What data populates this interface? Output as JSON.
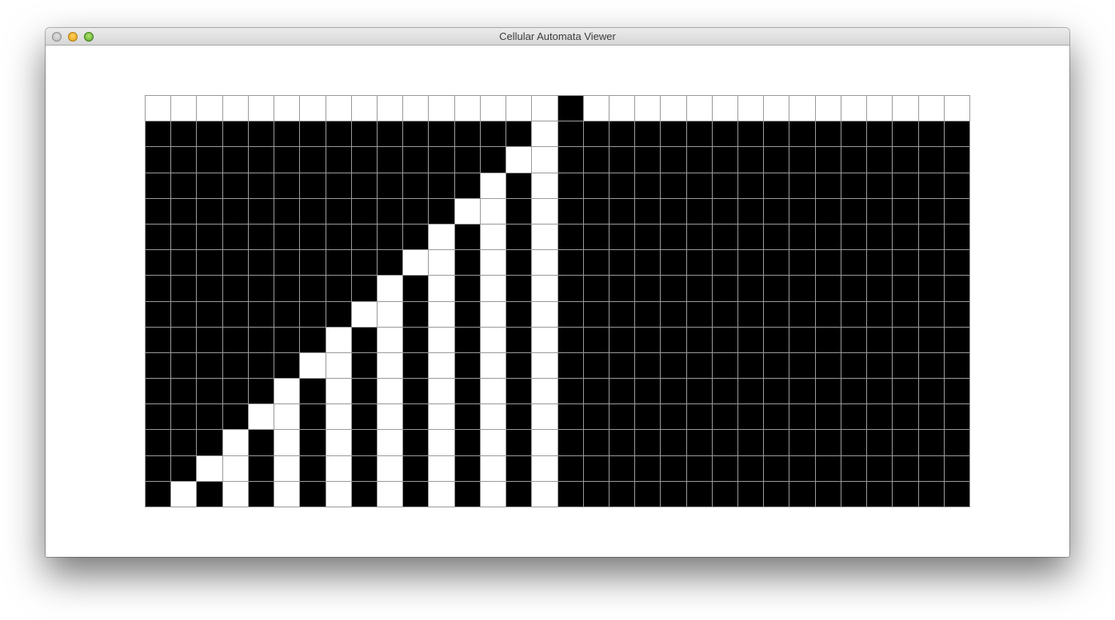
{
  "window": {
    "title": "Cellular Automata Viewer"
  },
  "titlebar_buttons": [
    {
      "name": "close",
      "color": "#c4c4c4"
    },
    {
      "name": "minimize",
      "color": "#f0b429"
    },
    {
      "name": "zoom",
      "color": "#6cbd3a"
    }
  ],
  "colors": {
    "live_cell": "#000000",
    "dead_cell": "#ffffff",
    "grid_line": "#9a9a9a"
  },
  "automaton": {
    "columns": 32,
    "rows": 16,
    "cells": [
      "00000000000000001000000000000000",
      "11111111111111101111111111111111",
      "11111111111111001111111111111111",
      "11111111111110101111111111111111",
      "11111111111100101111111111111111",
      "11111111111010101111111111111111",
      "11111111110010101111111111111111",
      "11111111101010101111111111111111",
      "11111111001010101111111111111111",
      "11111110101010101111111111111111",
      "11111100101010101111111111111111",
      "11111010101010101111111111111111",
      "11110010101010101111111111111111",
      "11101010101010101111111111111111",
      "11001010101010101111111111111111",
      "10101010101010101111111111111111"
    ]
  }
}
